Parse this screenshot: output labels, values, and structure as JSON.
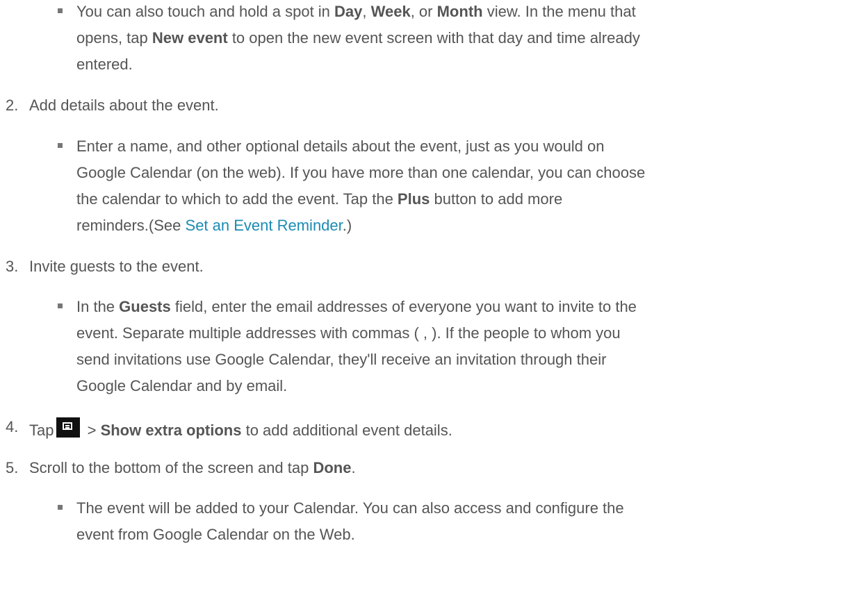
{
  "bullet1": {
    "l1_a": "You can also touch and hold a spot in ",
    "l1_day": "Day",
    "l1_b": ", ",
    "l1_week": "Week",
    "l1_c": ", or ",
    "l1_month": "Month",
    "l1_d": " view. In the menu that",
    "l2_a": "opens, tap ",
    "l2_new_event": "New event",
    "l2_b": " to open the new event screen with that day and time already",
    "l3": "entered."
  },
  "step2": {
    "number": "2.",
    "text": "Add details about the event."
  },
  "bullet2": {
    "l1": "Enter a name, and other optional details about the event, just as you would on",
    "l2": "Google Calendar (on the web). If you have more than one calendar, you can choose",
    "l3_a": "the calendar to which to add the event. Tap the ",
    "l3_plus": "Plus",
    "l3_b": " button to add more",
    "l4_a": "reminders.(See ",
    "l4_link": "Set an Event Reminder",
    "l4_b": ".)"
  },
  "step3": {
    "number": "3.",
    "text": "Invite guests to the event."
  },
  "bullet3": {
    "l1_a": "In the ",
    "l1_guests": "Guests",
    "l1_b": " field, enter the email addresses of everyone you want to invite to the",
    "l2": "event. Separate multiple addresses with commas ( , ). If the people to whom you",
    "l3": "send invitations use Google Calendar, they'll receive an invitation through their",
    "l4": "Google Calendar and by email."
  },
  "step4": {
    "number": "4.",
    "text_a": "Tap",
    "icon": "menu-icon",
    "text_b": " > ",
    "bold": "Show extra options",
    "text_c": " to add additional event details."
  },
  "step5": {
    "number": "5.",
    "text_a": "Scroll to the bottom of the screen and tap ",
    "bold": "Done",
    "text_b": "."
  },
  "bullet5": {
    "l1": "The event will be added to your Calendar. You can also access and configure the",
    "l2": "event from Google Calendar on the Web."
  }
}
